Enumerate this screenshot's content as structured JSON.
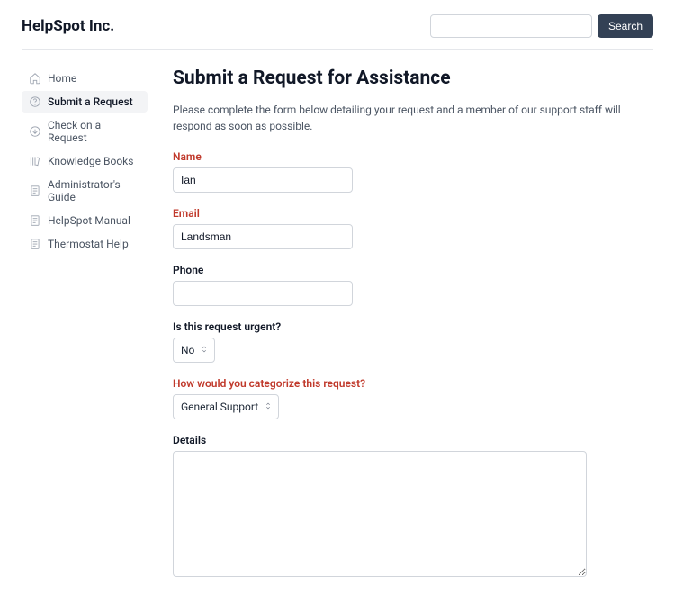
{
  "header": {
    "brand": "HelpSpot Inc.",
    "search_button": "Search",
    "search_placeholder": ""
  },
  "sidebar": {
    "items": [
      {
        "label": "Home"
      },
      {
        "label": "Submit a Request"
      },
      {
        "label": "Check on a Request"
      },
      {
        "label": "Knowledge Books"
      },
      {
        "label": "Administrator's Guide"
      },
      {
        "label": "HelpSpot Manual"
      },
      {
        "label": "Thermostat Help"
      }
    ]
  },
  "main": {
    "title": "Submit a Request for Assistance",
    "intro": "Please complete the form below detailing your request and a member of our support staff will respond as soon as possible.",
    "labels": {
      "name": "Name",
      "email": "Email",
      "phone": "Phone",
      "urgent": "Is this request urgent?",
      "category": "How would you categorize this request?",
      "details": "Details"
    },
    "values": {
      "name": "Ian",
      "email": "Landsman",
      "phone": "",
      "urgent": "No",
      "category": "General Support",
      "details": ""
    }
  }
}
